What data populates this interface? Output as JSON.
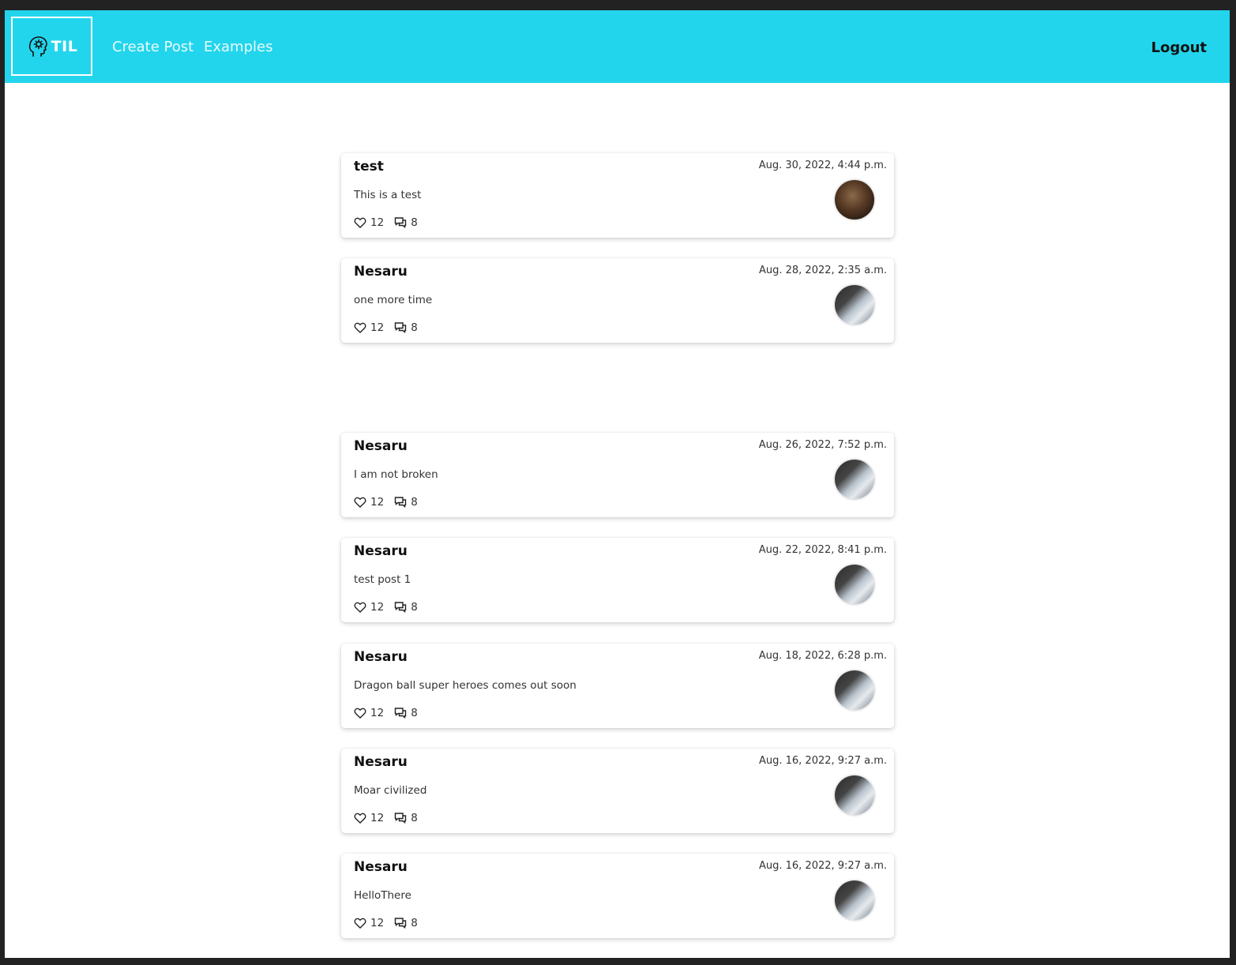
{
  "nav": {
    "brand": "TIL",
    "links": [
      "Create Post",
      "Examples"
    ],
    "logout": "Logout"
  },
  "posts": [
    {
      "author": "test",
      "date": "Aug. 30, 2022, 4:44 p.m.",
      "body": "This is a test",
      "likes": "12",
      "comments": "8"
    },
    {
      "author": "Nesaru",
      "date": "Aug. 28, 2022, 2:35 a.m.",
      "body": "one more time",
      "likes": "12",
      "comments": "8"
    },
    {
      "author": "Nesaru",
      "date": "Aug. 26, 2022, 7:52 p.m.",
      "body": "I am not broken",
      "likes": "12",
      "comments": "8"
    },
    {
      "author": "Nesaru",
      "date": "Aug. 22, 2022, 8:41 p.m.",
      "body": "test post 1",
      "likes": "12",
      "comments": "8"
    },
    {
      "author": "Nesaru",
      "date": "Aug. 18, 2022, 6:28 p.m.",
      "body": "Dragon ball super heroes comes out soon",
      "likes": "12",
      "comments": "8"
    },
    {
      "author": "Nesaru",
      "date": "Aug. 16, 2022, 9:27 a.m.",
      "body": "Moar civilized",
      "likes": "12",
      "comments": "8"
    },
    {
      "author": "Nesaru",
      "date": "Aug. 16, 2022, 9:27 a.m.",
      "body": "HelloThere",
      "likes": "12",
      "comments": "8"
    }
  ],
  "colors": {
    "navbar": "#22d5ec",
    "background": "#ffffff"
  }
}
